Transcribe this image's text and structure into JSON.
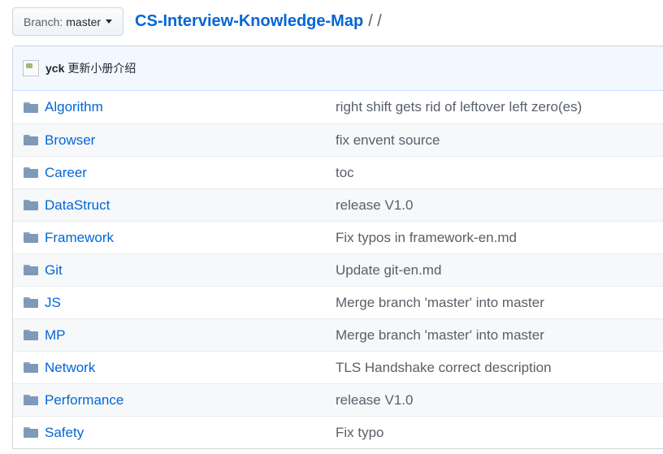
{
  "branch": {
    "prefix": "Branch:",
    "name": "master"
  },
  "breadcrumb": {
    "repo": "CS-Interview-Knowledge-Map",
    "separator": "/ /"
  },
  "latest_commit": {
    "author": "yck",
    "message": "更新小册介绍"
  },
  "files": [
    {
      "name": "Algorithm",
      "message": "right shift gets rid of leftover left zero(es)"
    },
    {
      "name": "Browser",
      "message": "fix envent source"
    },
    {
      "name": "Career",
      "message": "toc"
    },
    {
      "name": "DataStruct",
      "message": "release V1.0"
    },
    {
      "name": "Framework",
      "message": "Fix typos in framework-en.md"
    },
    {
      "name": "Git",
      "message": "Update git-en.md"
    },
    {
      "name": "JS",
      "message": "Merge branch 'master' into master"
    },
    {
      "name": "MP",
      "message": "Merge branch 'master' into master"
    },
    {
      "name": "Network",
      "message": "TLS Handshake correct description"
    },
    {
      "name": "Performance",
      "message": "release V1.0"
    },
    {
      "name": "Safety",
      "message": "Fix typo"
    }
  ]
}
